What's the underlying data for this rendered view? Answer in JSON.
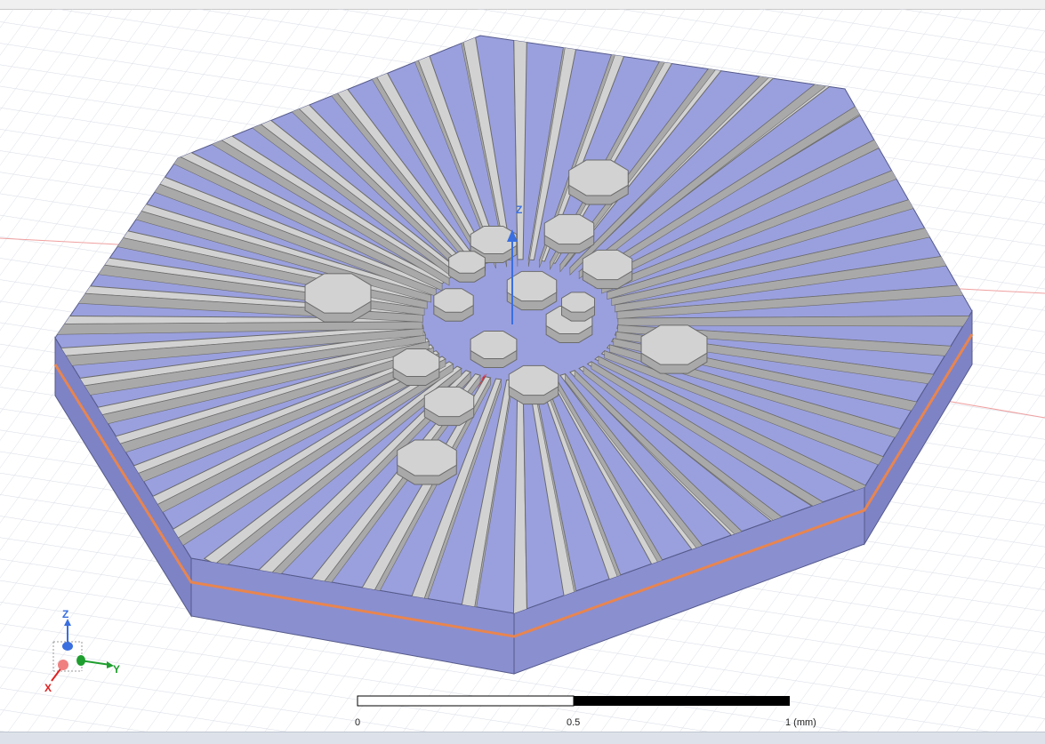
{
  "triad": {
    "z_label": "Z",
    "y_label": "Y",
    "x_label": "X"
  },
  "scale_bar": {
    "ticks": [
      "0",
      "0.5",
      "1 (mm)"
    ]
  },
  "colors": {
    "substrate_top": "#9aa0de",
    "substrate_side_front": "#8a8fd0",
    "substrate_side_left": "#7e83c6",
    "conductor_top": "#d2d2d2",
    "conductor_side": "#a9a9a9",
    "copper_layer": "#e8854f",
    "grid_line": "#d9dde6",
    "axis_z": "#3a6fe0",
    "axis_y": "#1e9e2e",
    "axis_x": "#e02020"
  }
}
